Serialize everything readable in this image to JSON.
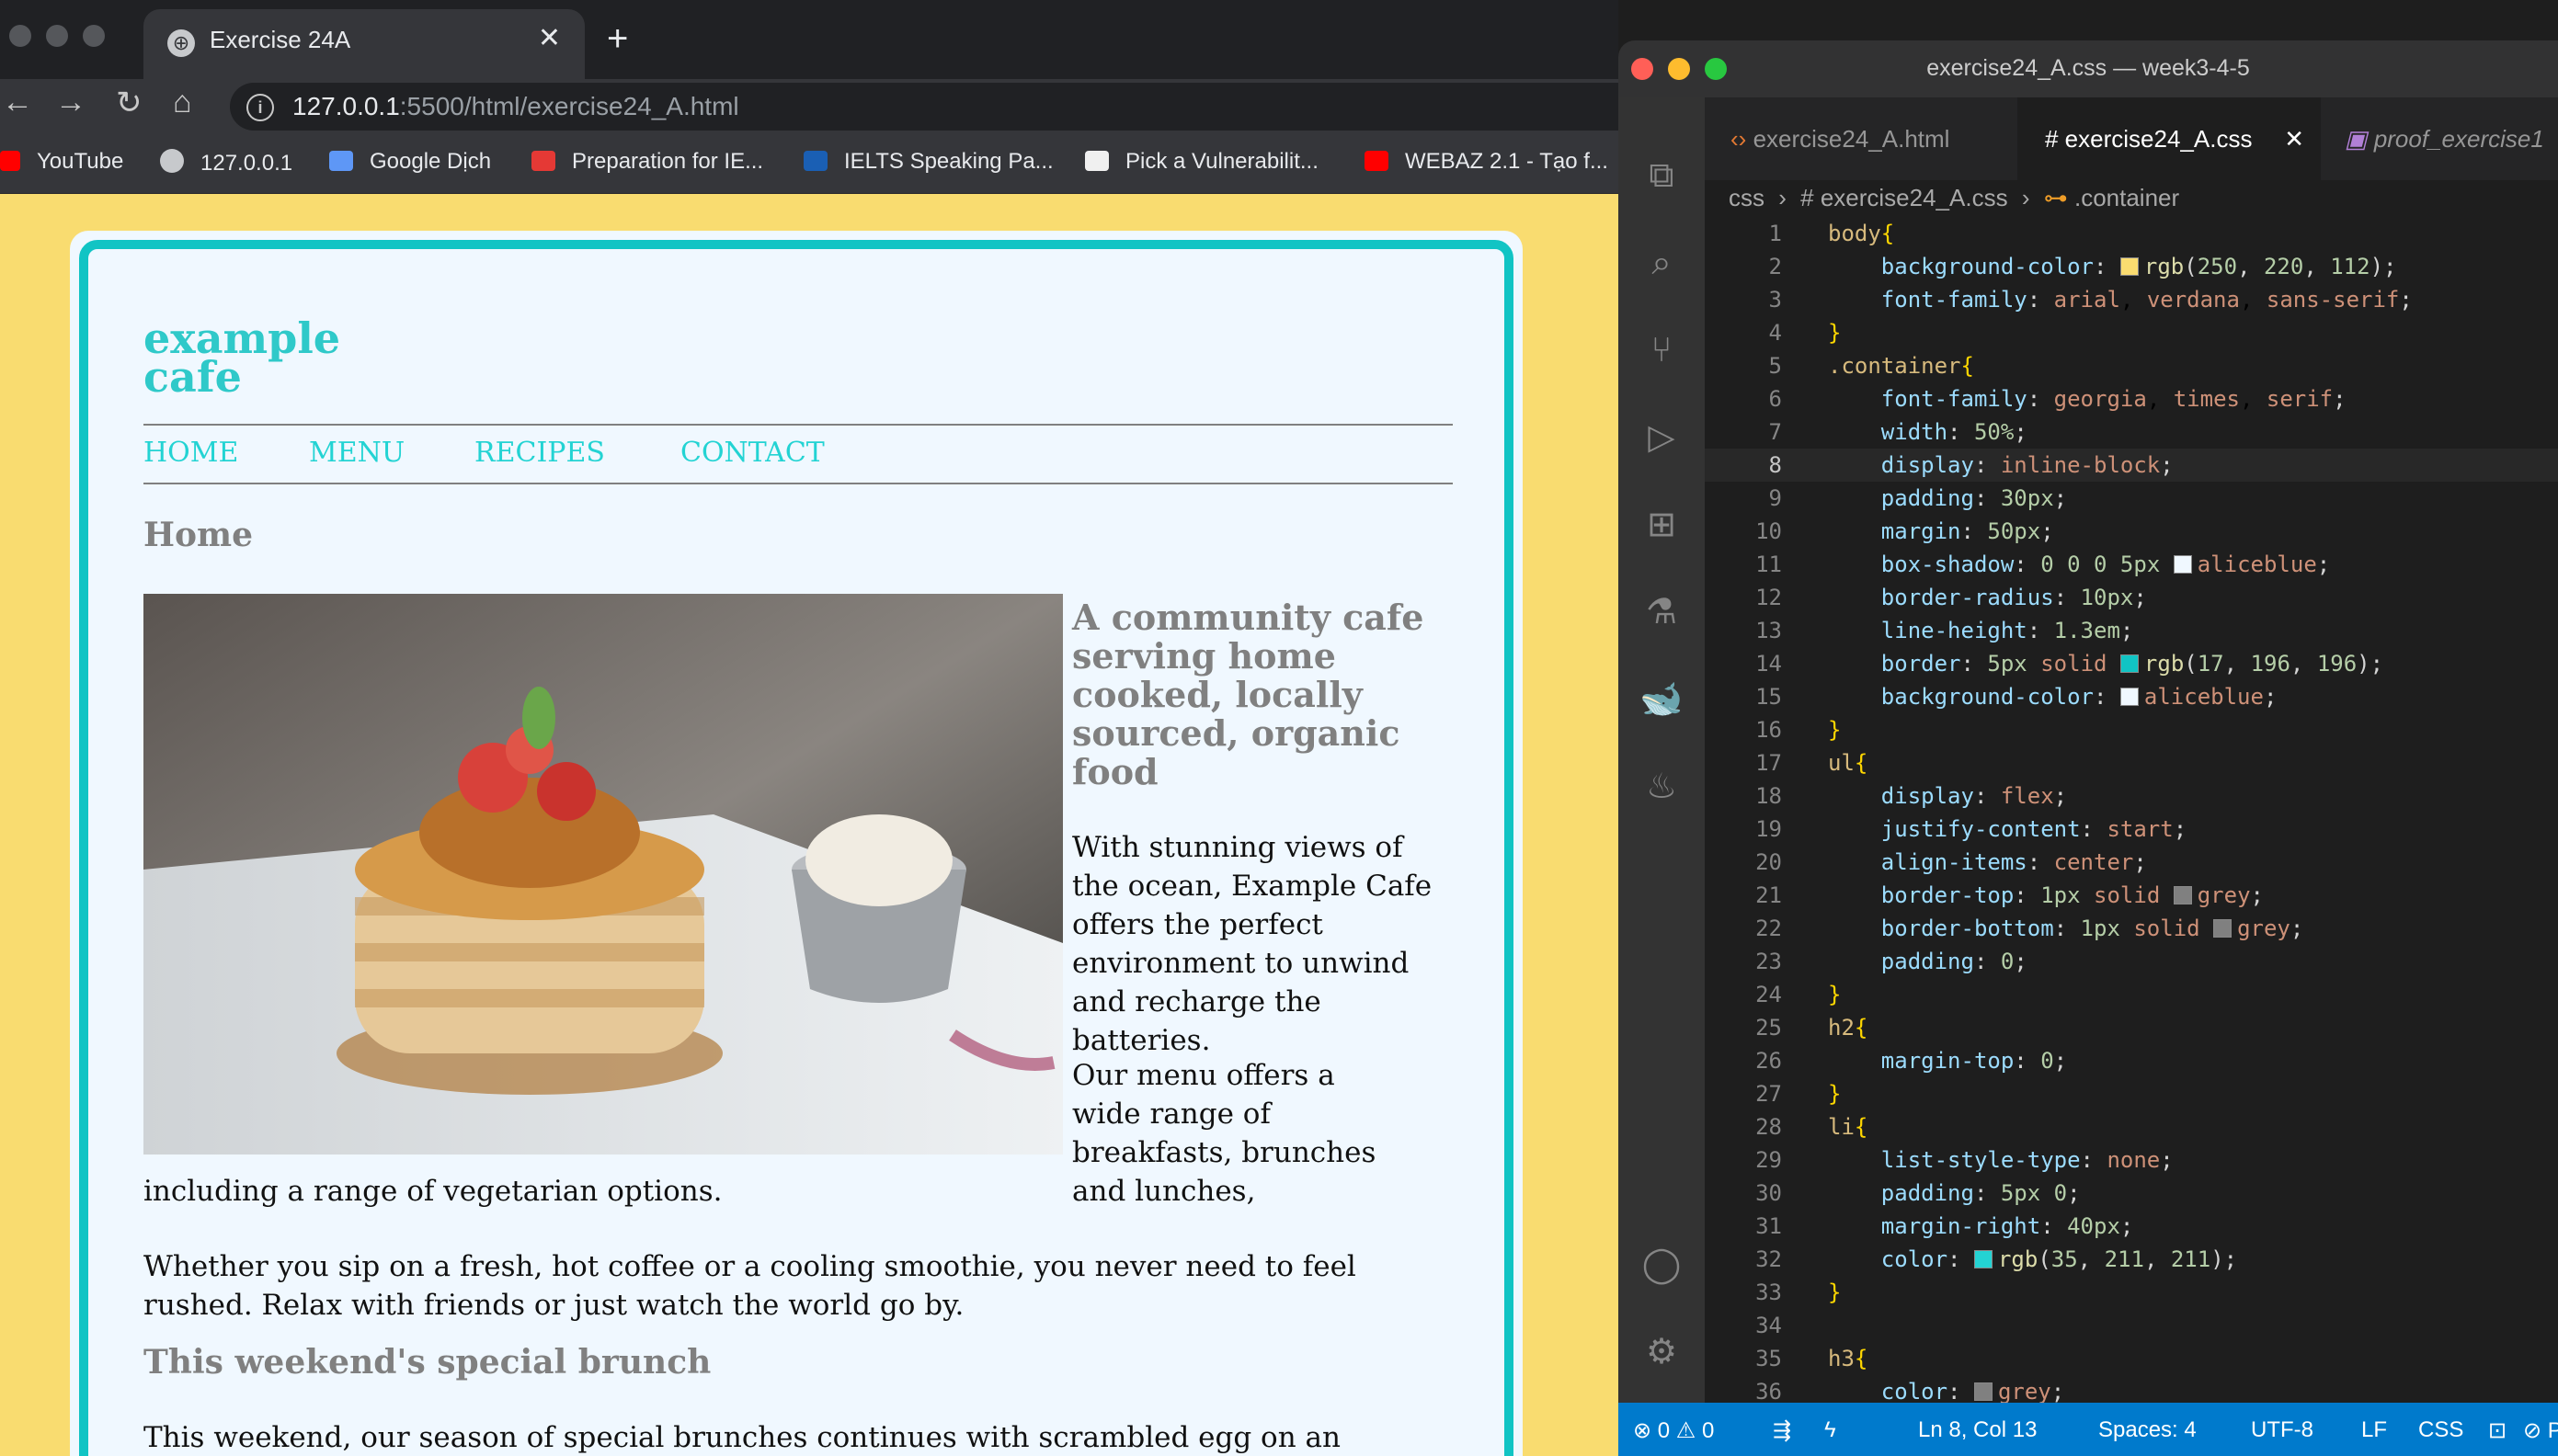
{
  "browser": {
    "tab_title": "Exercise 24A",
    "url_host": "127.0.0.1",
    "url_path": ":5500/html/exercise24_A.html",
    "bookmarks": [
      "YouTube",
      "127.0.0.1",
      "Google Dịch",
      "Preparation for IE...",
      "IELTS Speaking Pa...",
      "Pick a Vulnerabilit...",
      "WEBAZ 2.1 - Tạo f..."
    ]
  },
  "page": {
    "logo_line1": "example",
    "logo_line2": "cafe",
    "nav": [
      "HOME",
      "MENU",
      "RECIPES",
      "CONTACT"
    ],
    "section_title": "Home",
    "image": "pancake-stack-photo",
    "tagline": "A community cafe serving home cooked, locally sourced, organic food",
    "para1": "With stunning views of the ocean, Example Cafe offers the perfect environment to unwind and recharge the batteries.",
    "para2_wrapped": "Our menu offers a wide range of breakfasts, brunches and lunches,",
    "para2_rest": "including a range of vegetarian options.",
    "para3": "Whether you sip on a fresh, hot coffee or a cooling smoothie, you never need to feel rushed. Relax with friends or just watch the world go by.",
    "special_title": "This weekend's special brunch",
    "special_text": "This weekend, our season of special brunches continues with scrambled egg on an English muffin.",
    "colors": {
      "background": "#f9dc70",
      "border": "#11c4c4",
      "link": "#23d3d3",
      "container": "#f0f8ff"
    }
  },
  "editor": {
    "window_title": "exercise24_A.css — week3-4-5",
    "tabs": [
      "exercise24_A.html",
      "# exercise24_A.css",
      "proof_exercise1"
    ],
    "breadcrumb": [
      "css",
      "# exercise24_A.css",
      ".container"
    ],
    "code_lines": [
      "body{",
      "    background-color: rgb(250, 220, 112);",
      "    font-family: arial, verdana, sans-serif;",
      "}",
      ".container{",
      "    font-family: georgia, times, serif;",
      "    width: 50%;",
      "    display: inline-block;",
      "    padding: 30px;",
      "    margin: 50px;",
      "    box-shadow: 0 0 0 5px aliceblue;",
      "    border-radius: 10px;",
      "    line-height: 1.3em;",
      "    border: 5px solid rgb(17, 196, 196);",
      "    background-color: aliceblue;",
      "}",
      "ul{",
      "    display: flex;",
      "    justify-content: start;",
      "    align-items: center;",
      "    border-top: 1px solid grey;",
      "    border-bottom: 1px solid grey;",
      "    padding: 0;",
      "}",
      "h2{",
      "    margin-top: 0;",
      "}",
      "li{",
      "    list-style-type: none;",
      "    padding: 5px 0;",
      "    margin-right: 40px;",
      "    color: rgb(35, 211, 211);",
      "}",
      "",
      "h3{",
      "    color: grey;",
      "}"
    ],
    "current_line": 8,
    "status": {
      "problems": "0",
      "warnings": "0",
      "position": "Ln 8, Col 13",
      "spaces": "Spaces: 4",
      "encoding": "UTF-8",
      "eol": "LF",
      "language": "CSS",
      "port": "Port"
    }
  }
}
